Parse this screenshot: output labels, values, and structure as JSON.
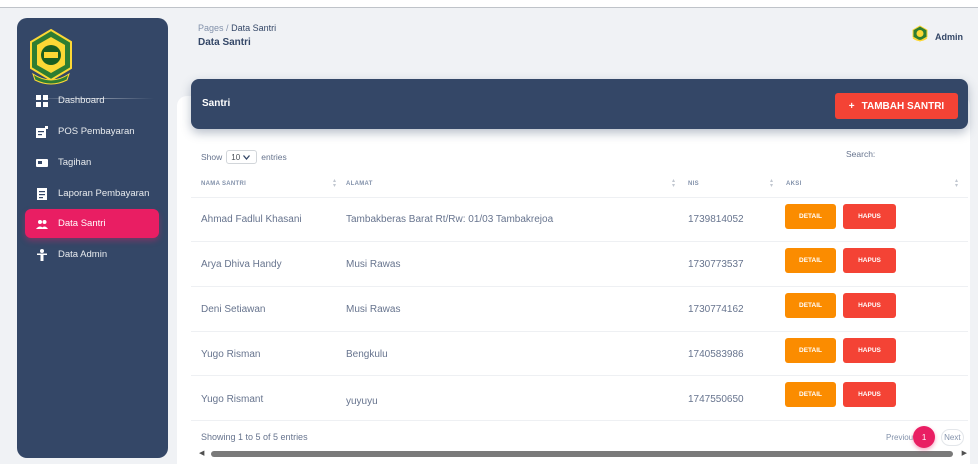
{
  "sidebar": {
    "items": [
      {
        "label": "Dashboard",
        "icon": "dashboard-icon"
      },
      {
        "label": "POS Pembayaran",
        "icon": "receipt-icon"
      },
      {
        "label": "Tagihan",
        "icon": "card-icon"
      },
      {
        "label": "Laporan Pembayaran",
        "icon": "report-icon"
      },
      {
        "label": "Data Santri",
        "icon": "people-icon"
      },
      {
        "label": "Data Admin",
        "icon": "person-icon"
      }
    ],
    "active_index": 4
  },
  "header": {
    "breadcrumb_root": "Pages",
    "breadcrumb_sep": "/",
    "breadcrumb_current": "Data Santri",
    "title": "Data Santri",
    "user_label": "Admin"
  },
  "card": {
    "title": "Santri",
    "add_plus": "+",
    "add_label": "TAMBAH SANTRI",
    "show_prefix": "Show",
    "show_value": "10",
    "show_suffix": "entries",
    "search_label": "Search:"
  },
  "table": {
    "columns": [
      "NAMA SANTRI",
      "ALAMAT",
      "NIS",
      "AKSI"
    ],
    "rows": [
      {
        "nama": "Ahmad Fadlul Khasani",
        "alamat": "Tambakberas Barat Rt/Rw: 01/03 Tambakrejoa",
        "nis": "1739814052"
      },
      {
        "nama": "Arya Dhiva Handy",
        "alamat": "Musi Rawas",
        "nis": "1730773537"
      },
      {
        "nama": "Deni Setiawan",
        "alamat": "Musi Rawas",
        "nis": "1730774162"
      },
      {
        "nama": "Yugo Risman",
        "alamat": "Bengkulu",
        "nis": "1740583986"
      },
      {
        "nama": "Yugo Rismant",
        "alamat": "yuyuyu",
        "nis": "1747550650"
      }
    ],
    "detail_label": "DETAIL",
    "hapus_label": "HAPUS"
  },
  "footer": {
    "showing": "Showing 1 to 5 of 5 entries",
    "prev": "Previous",
    "page": "1",
    "next": "Next"
  },
  "colors": {
    "sidebar_bg": "#344767",
    "active": "#e91e63",
    "add_button": "#f44335",
    "detail_button": "#fb8c00",
    "hapus_button": "#f44335"
  }
}
